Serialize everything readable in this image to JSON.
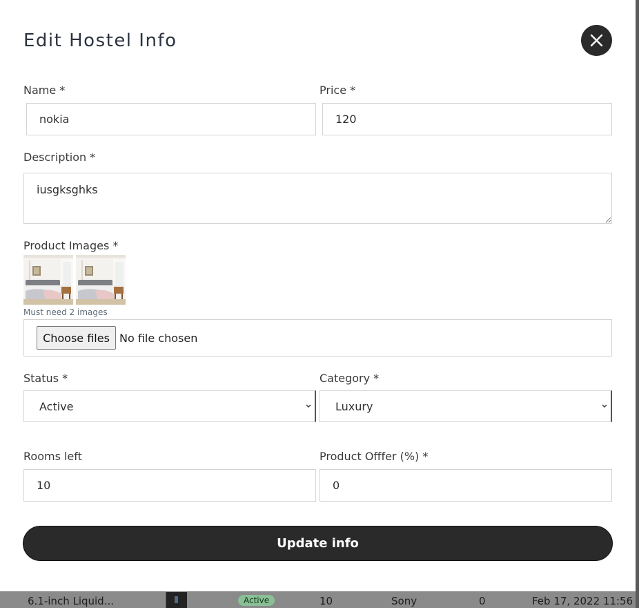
{
  "modal": {
    "title": "Edit Hostel Info",
    "close_icon": "close-icon"
  },
  "form": {
    "name_label": "Name *",
    "name_value": "nokia",
    "price_label": "Price *",
    "price_value": "120",
    "description_label": "Description *",
    "description_value": "iusgksghks",
    "images_label": "Product Images *",
    "images_hint": "Must need 2 images",
    "file_button": "Choose files",
    "file_status": "No file chosen",
    "status_label": "Status *",
    "status_value": "Active",
    "category_label": "Category *",
    "category_value": "Luxury",
    "rooms_label": "Rooms left",
    "rooms_value": "10",
    "offer_label": "Product Offfer (%) *",
    "offer_value": "0",
    "submit_label": "Update info"
  },
  "background_row": {
    "name": "6.1-inch Liquid...",
    "status": "Active",
    "rooms": "10",
    "brand": "Sony",
    "offer": "0",
    "date": "Feb 17, 2022 11:56"
  }
}
